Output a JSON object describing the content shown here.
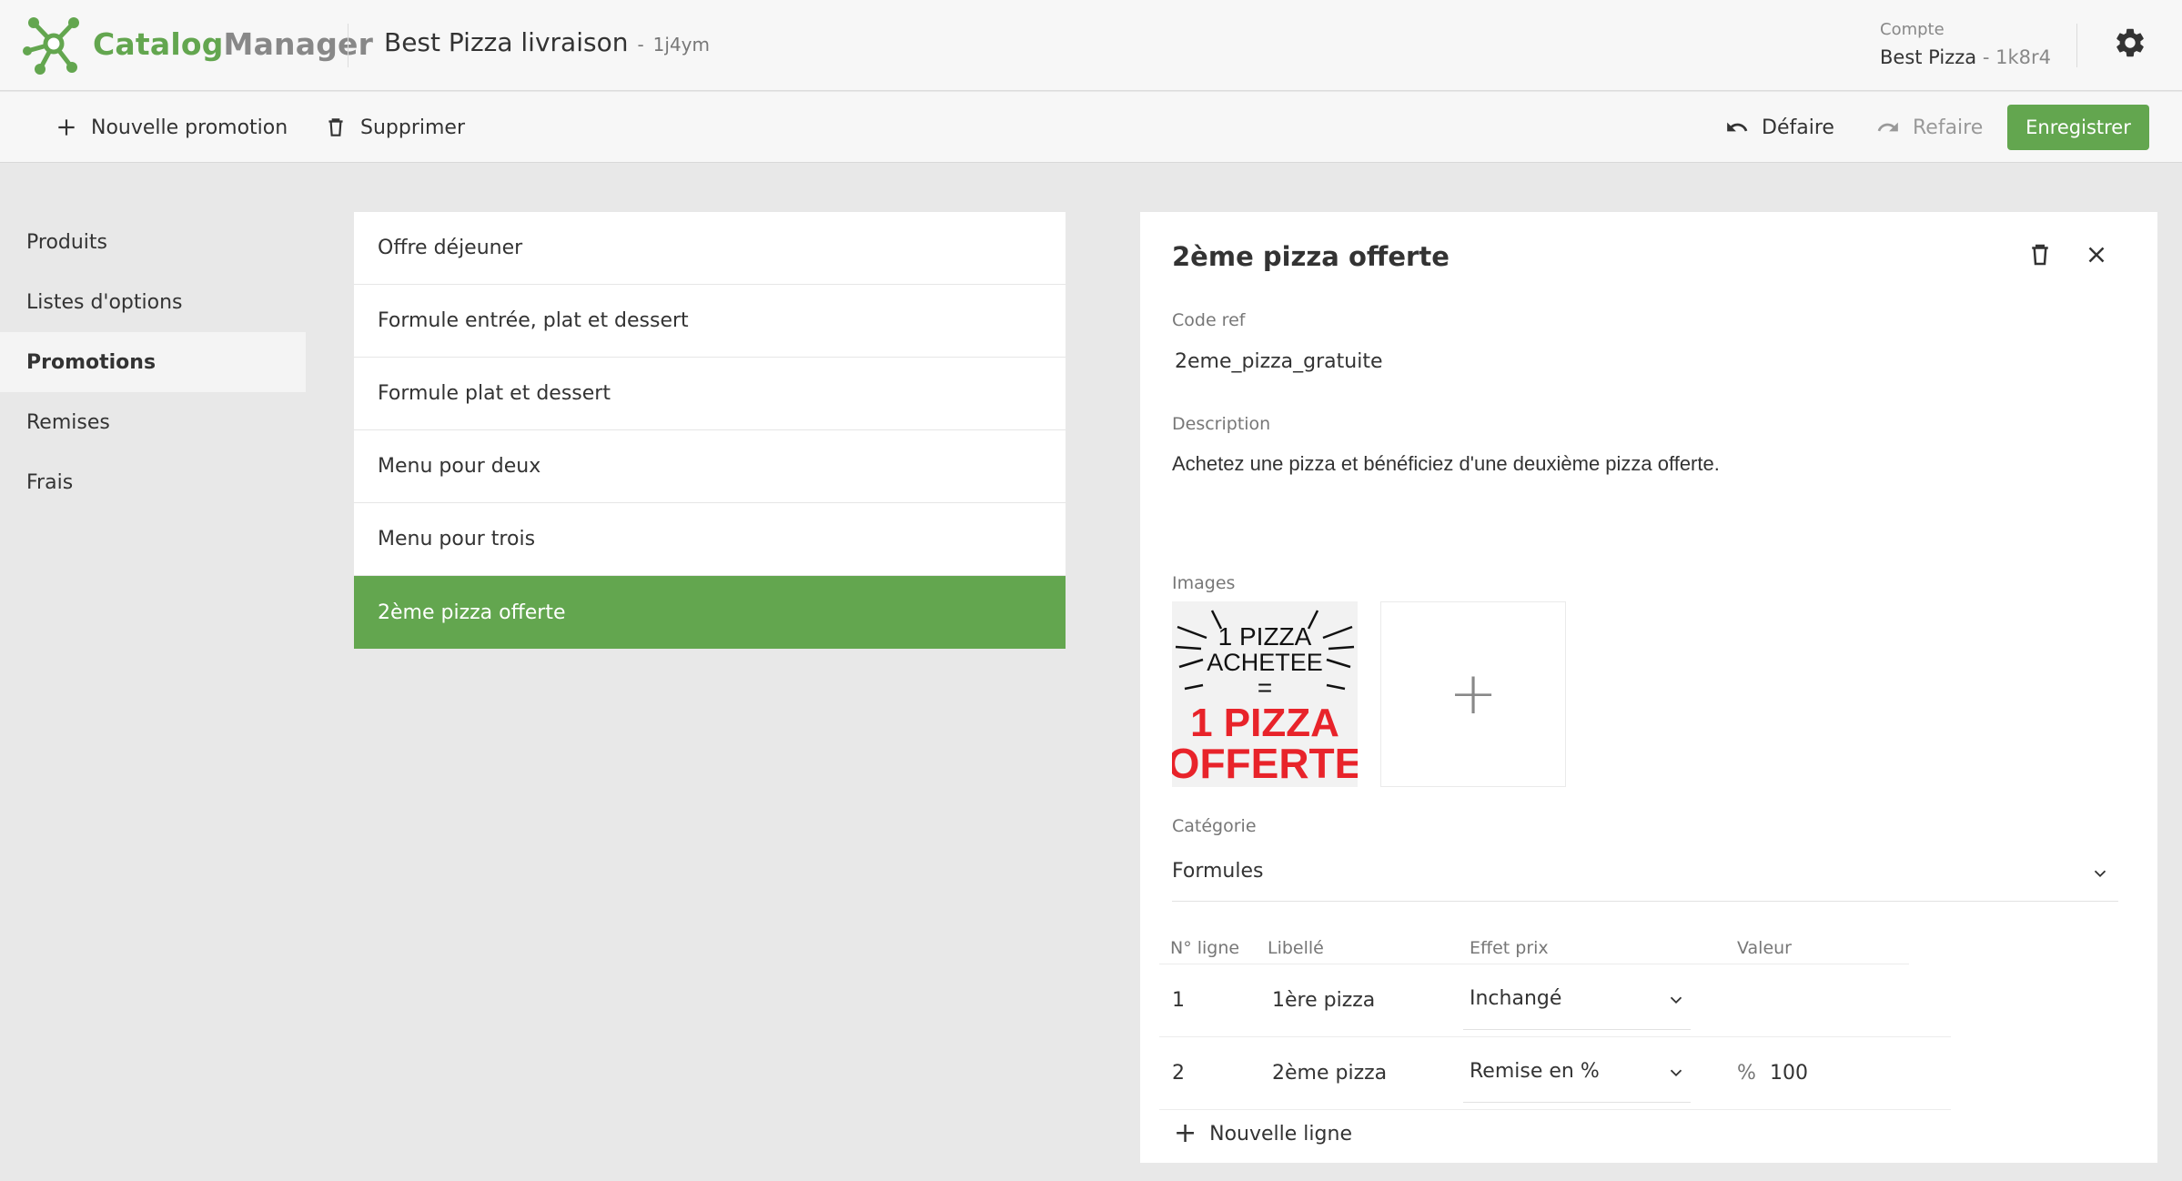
{
  "app": {
    "logo_part1": "Catalog",
    "logo_part2": "Manager",
    "store_name": "Best Pizza livraison",
    "store_separator": "-",
    "store_id": "1j4ym",
    "account_label": "Compte",
    "account_name": "Best Pizza",
    "account_separator": " - ",
    "account_id": "1k8r4"
  },
  "toolbar": {
    "new_promo": "Nouvelle promotion",
    "delete": "Supprimer",
    "undo": "Défaire",
    "redo": "Refaire",
    "save": "Enregistrer"
  },
  "sidebar": {
    "items": [
      "Produits",
      "Listes d'options",
      "Promotions",
      "Remises",
      "Frais"
    ],
    "active_index": 2
  },
  "list": {
    "items": [
      "Offre déjeuner",
      "Formule entrée, plat et dessert",
      "Formule plat et dessert",
      "Menu pour deux",
      "Menu pour trois",
      "2ème pizza offerte"
    ],
    "active_index": 5
  },
  "detail": {
    "title": "2ème pizza offerte",
    "code_label": "Code ref",
    "code_value": "2eme_pizza_gratuite",
    "description_label": "Description",
    "description_value": "Achetez une pizza et bénéficiez d'une deuxième pizza offerte.",
    "images_label": "Images",
    "image_text": {
      "line1": "1 PIZZA",
      "line2": "ACHETEE",
      "line3": "=",
      "line4": "1 PIZZA",
      "line5": "OFFERTE"
    },
    "add_image": "+",
    "category_label": "Catégorie",
    "category_value": "Formules",
    "table": {
      "headers": [
        "N° ligne",
        "Libellé",
        "Effet prix",
        "Valeur"
      ],
      "rows": [
        {
          "num": "1",
          "label": "1ère pizza",
          "effect": "Inchangé",
          "unit": "",
          "value": ""
        },
        {
          "num": "2",
          "label": "2ème pizza",
          "effect": "Remise en %",
          "unit": "%",
          "value": "100"
        }
      ]
    },
    "add_line": "Nouvelle ligne"
  },
  "colors": {
    "accent": "#63a64f",
    "background": "#e8e8e8",
    "header_bg": "#f7f7f7",
    "image_red": "#e8232a"
  },
  "icons": [
    "logo-network-icon",
    "gear-icon",
    "plus-icon",
    "trash-icon",
    "undo-icon",
    "redo-icon",
    "close-icon",
    "chevron-down-icon"
  ]
}
